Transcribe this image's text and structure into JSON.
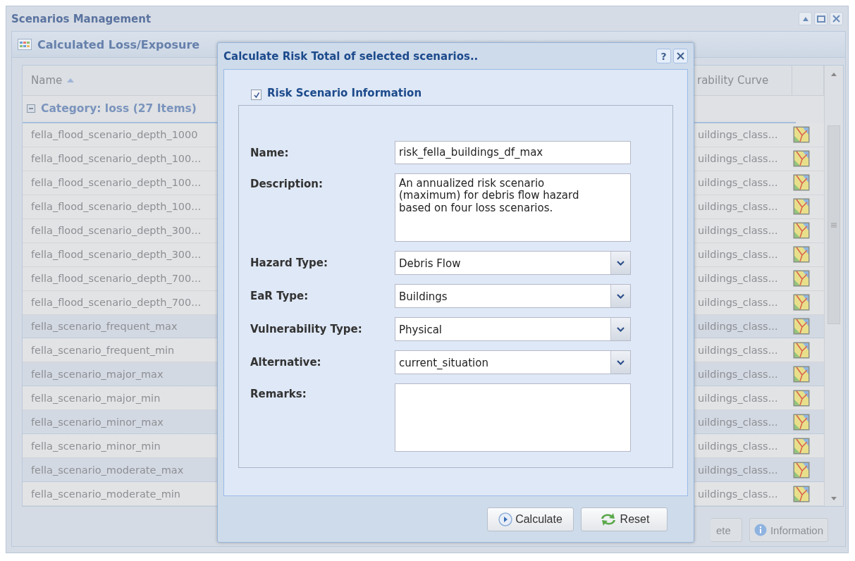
{
  "window": {
    "title": "Scenarios Management"
  },
  "panel": {
    "title": "Calculated Loss/Exposure"
  },
  "grid": {
    "columns": [
      {
        "label": "Name",
        "sort_ascending": true
      },
      {
        "label": "rability Curve"
      }
    ],
    "group": {
      "label": "Category: loss (27 Items)",
      "expanded": true
    },
    "rows": [
      {
        "name": "fella_flood_scenario_depth_1000",
        "curve": "uildings_class...",
        "selected": false
      },
      {
        "name": "fella_flood_scenario_depth_100...",
        "curve": "uildings_class...",
        "selected": false
      },
      {
        "name": "fella_flood_scenario_depth_100...",
        "curve": "uildings_class...",
        "selected": false
      },
      {
        "name": "fella_flood_scenario_depth_100...",
        "curve": "uildings_class...",
        "selected": false
      },
      {
        "name": "fella_flood_scenario_depth_300...",
        "curve": "uildings_class...",
        "selected": false
      },
      {
        "name": "fella_flood_scenario_depth_300...",
        "curve": "uildings_class...",
        "selected": false
      },
      {
        "name": "fella_flood_scenario_depth_700...",
        "curve": "uildings_class...",
        "selected": false
      },
      {
        "name": "fella_flood_scenario_depth_700...",
        "curve": "uildings_class...",
        "selected": false
      },
      {
        "name": "fella_scenario_frequent_max",
        "curve": "uildings_class...",
        "selected": true
      },
      {
        "name": "fella_scenario_frequent_min",
        "curve": "uildings_class...",
        "selected": false
      },
      {
        "name": "fella_scenario_major_max",
        "curve": "uildings_class...",
        "selected": true
      },
      {
        "name": "fella_scenario_major_min",
        "curve": "uildings_class...",
        "selected": false
      },
      {
        "name": "fella_scenario_minor_max",
        "curve": "uildings_class...",
        "selected": true
      },
      {
        "name": "fella_scenario_minor_min",
        "curve": "uildings_class...",
        "selected": false
      },
      {
        "name": "fella_scenario_moderate_max",
        "curve": "uildings_class...",
        "selected": true
      },
      {
        "name": "fella_scenario_moderate_min",
        "curve": "uildings_class...",
        "selected": false
      }
    ]
  },
  "buttons": [
    {
      "kind": "plain",
      "label": "ete"
    },
    {
      "kind": "info",
      "label": "Information"
    }
  ],
  "dialog": {
    "title": "Calculate Risk Total of selected scenarios..",
    "help": "?",
    "fieldset": {
      "legend": "Risk Scenario Information",
      "checked": true
    },
    "fields": [
      {
        "kind": "text",
        "label": "Name:",
        "value": "risk_fella_buildings_df_max"
      },
      {
        "kind": "textarea",
        "label": "Description:",
        "value": "An annualized risk scenario (maximum) for debris flow hazard based on four loss scenarios."
      },
      {
        "kind": "combo",
        "label": "Hazard Type:",
        "value": "Debris Flow"
      },
      {
        "kind": "combo",
        "label": "EaR Type:",
        "value": "Buildings"
      },
      {
        "kind": "combo",
        "label": "Vulnerability Type:",
        "value": "Physical"
      },
      {
        "kind": "combo",
        "label": "Alternative:",
        "value": "current_situation"
      },
      {
        "kind": "textarea",
        "label": "Remarks:"
      }
    ],
    "buttons": [
      {
        "kind": "calculate",
        "label": "Calculate"
      },
      {
        "kind": "reset",
        "label": "Reset"
      }
    ]
  }
}
